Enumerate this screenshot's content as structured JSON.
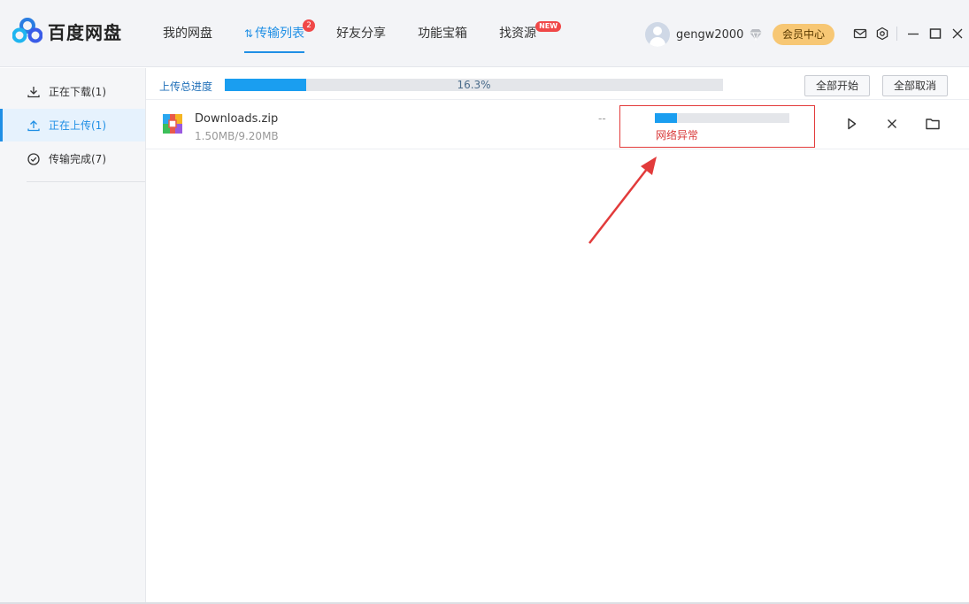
{
  "app": {
    "brand": "百度网盘"
  },
  "nav": {
    "items": [
      {
        "label": "我的网盘"
      },
      {
        "label": "传输列表",
        "badge": "2",
        "active": true
      },
      {
        "label": "好友分享"
      },
      {
        "label": "功能宝箱"
      },
      {
        "label": "找资源",
        "badge": "NEW"
      }
    ]
  },
  "user": {
    "name": "gengw2000",
    "member_label": "会员中心"
  },
  "sidebar": {
    "items": [
      {
        "label": "正在下载(1)",
        "icon": "download-icon"
      },
      {
        "label": "正在上传(1)",
        "icon": "upload-icon",
        "active": true
      },
      {
        "label": "传输完成(7)",
        "icon": "check-circle-icon"
      }
    ]
  },
  "summary": {
    "label": "上传总进度",
    "progress_text": "16.3%",
    "progress": 0.163,
    "start_all": "全部开始",
    "cancel_all": "全部取消"
  },
  "transfers": [
    {
      "name": "Downloads.zip",
      "size": "1.50MB/9.20MB",
      "speed": "--",
      "progress": 0.163,
      "status": "网络异常"
    }
  ],
  "colors": {
    "accent": "#1f8fe5",
    "progress": "#1a9ef0",
    "error": "#e23b3b",
    "member": "#f7c774"
  }
}
